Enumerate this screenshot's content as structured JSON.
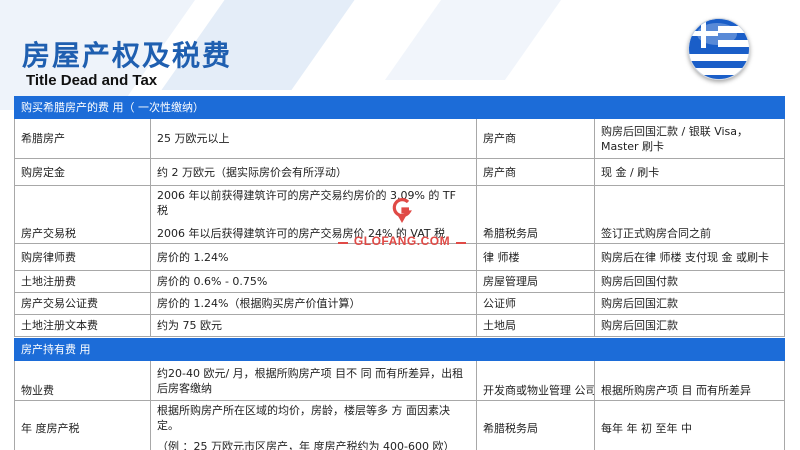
{
  "header": {
    "title": "房屋产权及税费",
    "subtitle": "Title Dead and Tax"
  },
  "colors": {
    "accent_blue": "#1c6cd8",
    "title_blue": "#1f5fb0",
    "watermark_red": "#e04a46"
  },
  "watermark": {
    "text": "GLOFANG.COM"
  },
  "purchase": {
    "heading": "购买希腊房产的费 用（ 一次性缴纳）",
    "rows": [
      {
        "item": "希腊房产",
        "cost": "25 万欧元以上",
        "party": "房产商",
        "method": "购房后回国汇款 / 银联 Visa，Master 刷卡"
      },
      {
        "item": "购房定金",
        "cost": "约 2 万欧元（据实际房价会有所浮动）",
        "party": "房产商",
        "method": "现 金 / 刷卡"
      },
      {
        "item": "房产交易税",
        "cost_line1": "2006 年以前获得建筑许可的房产交易约房价的 3.09% 的 TF 税",
        "cost_line2": "2006 年以后获得建筑许可的房产交易房价 24% 的 VAT 税",
        "party": "希腊税务局",
        "method": "签订正式购房合同之前"
      },
      {
        "item": "购房律师费",
        "cost": "房价的 1.24%",
        "party": "律 师楼",
        "method": "购房后在律 师楼 支付现 金 或刷卡"
      },
      {
        "item": "土地注册费",
        "cost": "房价的 0.6% - 0.75%",
        "party": "房屋管理局",
        "method": "购房后回国付款"
      },
      {
        "item": "房产交易公证费",
        "cost": "房价的 1.24%（根据购买房产价值计算）",
        "party": "公证师",
        "method": "购房后回国汇款"
      },
      {
        "item": "土地注册文本费",
        "cost": "约为 75 欧元",
        "party": "土地局",
        "method": "购房后回国汇款"
      }
    ]
  },
  "holding": {
    "heading": "房产持有费 用",
    "rows": [
      {
        "item": "物业费",
        "cost": "约20-40 欧元/ 月，根据所购房产项 目不 同 而有所差异，出租后房客缴纳",
        "party": "开发商或物业管理 公司",
        "method": "根据所购房产项 目 而有所差异"
      },
      {
        "item": "年 度房产税",
        "cost_line1": "根据所购房产所在区域的均价，房龄，楼层等多 方 面因素决定。",
        "cost_line2": "（例 ：25 万欧元市区房产，年 度房产税约为 400-600 欧）",
        "party": "希腊税务局",
        "method": "每年 年 初 至年 中"
      }
    ]
  }
}
